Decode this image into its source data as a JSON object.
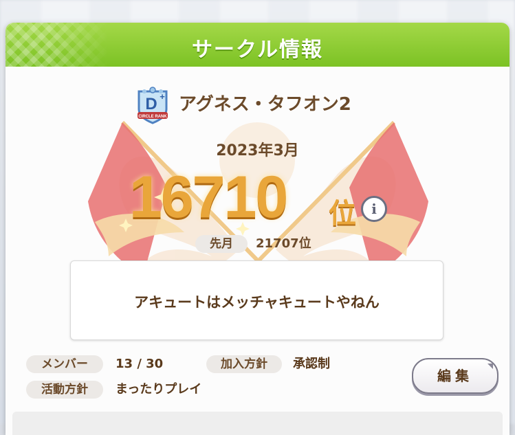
{
  "header": {
    "title": "サークル情報"
  },
  "circle": {
    "rank_badge_letter": "D",
    "rank_badge_suffix": "+",
    "rank_badge_caption": "CIRCLE RANK",
    "name": "アグネス・タフオン2"
  },
  "ranking": {
    "month": "2023年3月",
    "rank": "16710",
    "rank_unit": "位",
    "info_icon": "i",
    "last_month_label": "先月",
    "last_month_value": "21707位"
  },
  "message": "アキュートはメッチャキュートやねん",
  "details": {
    "members_label": "メンバー",
    "members_value": "13 / 30",
    "join_policy_label": "加入方針",
    "join_policy_value": "承認制",
    "activity_label": "活動方針",
    "activity_value": "まったりプレイ"
  },
  "actions": {
    "edit_label": "編集"
  },
  "colors": {
    "header_green": "#8ccb30",
    "text_brown": "#6b4a2a",
    "rank_gold": "#e9a63a",
    "flag_red": "#e56a6a"
  }
}
